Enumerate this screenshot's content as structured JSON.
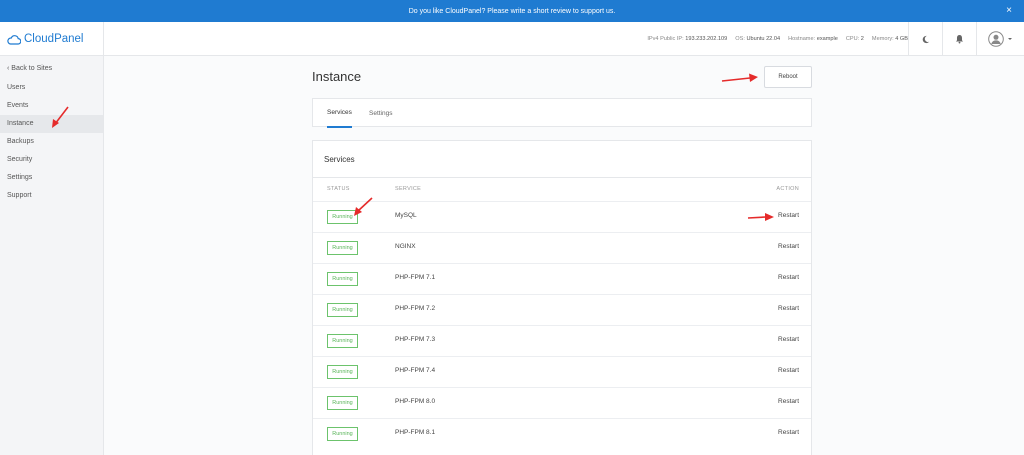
{
  "banner": {
    "text": "Do you like CloudPanel? Please write a short review to support us.",
    "close": "×"
  },
  "logo": {
    "part1": "Cloud",
    "part2": "Panel"
  },
  "system": {
    "ip_label": "IPv4 Public IP:",
    "ip": "193.233.202.109",
    "os_label": "OS:",
    "os": "Ubuntu 22.04",
    "host_label": "Hostname:",
    "host": "example",
    "cpu_label": "CPU:",
    "cpu": "2",
    "mem_label": "Memory:",
    "mem": "4 GB"
  },
  "sidebar": {
    "back": "Back to Sites",
    "items": [
      {
        "label": "Users"
      },
      {
        "label": "Events"
      },
      {
        "label": "Instance"
      },
      {
        "label": "Backups"
      },
      {
        "label": "Security"
      },
      {
        "label": "Settings"
      },
      {
        "label": "Support"
      }
    ],
    "active": "Instance"
  },
  "page": {
    "title": "Instance",
    "reboot": "Reboot"
  },
  "tabs": [
    {
      "label": "Services"
    },
    {
      "label": "Settings"
    }
  ],
  "services": {
    "title": "Services",
    "headers": {
      "status": "STATUS",
      "service": "SERVICE",
      "action": "ACTION"
    },
    "rows": [
      {
        "status": "Running",
        "name": "MySQL",
        "action": "Restart"
      },
      {
        "status": "Running",
        "name": "NGINX",
        "action": "Restart"
      },
      {
        "status": "Running",
        "name": "PHP-FPM 7.1",
        "action": "Restart"
      },
      {
        "status": "Running",
        "name": "PHP-FPM 7.2",
        "action": "Restart"
      },
      {
        "status": "Running",
        "name": "PHP-FPM 7.3",
        "action": "Restart"
      },
      {
        "status": "Running",
        "name": "PHP-FPM 7.4",
        "action": "Restart"
      },
      {
        "status": "Running",
        "name": "PHP-FPM 8.0",
        "action": "Restart"
      },
      {
        "status": "Running",
        "name": "PHP-FPM 8.1",
        "action": "Restart"
      }
    ]
  },
  "colors": {
    "accent": "#1f7bd1",
    "running": "#5ab55a",
    "annotation": "#e52b2b"
  }
}
